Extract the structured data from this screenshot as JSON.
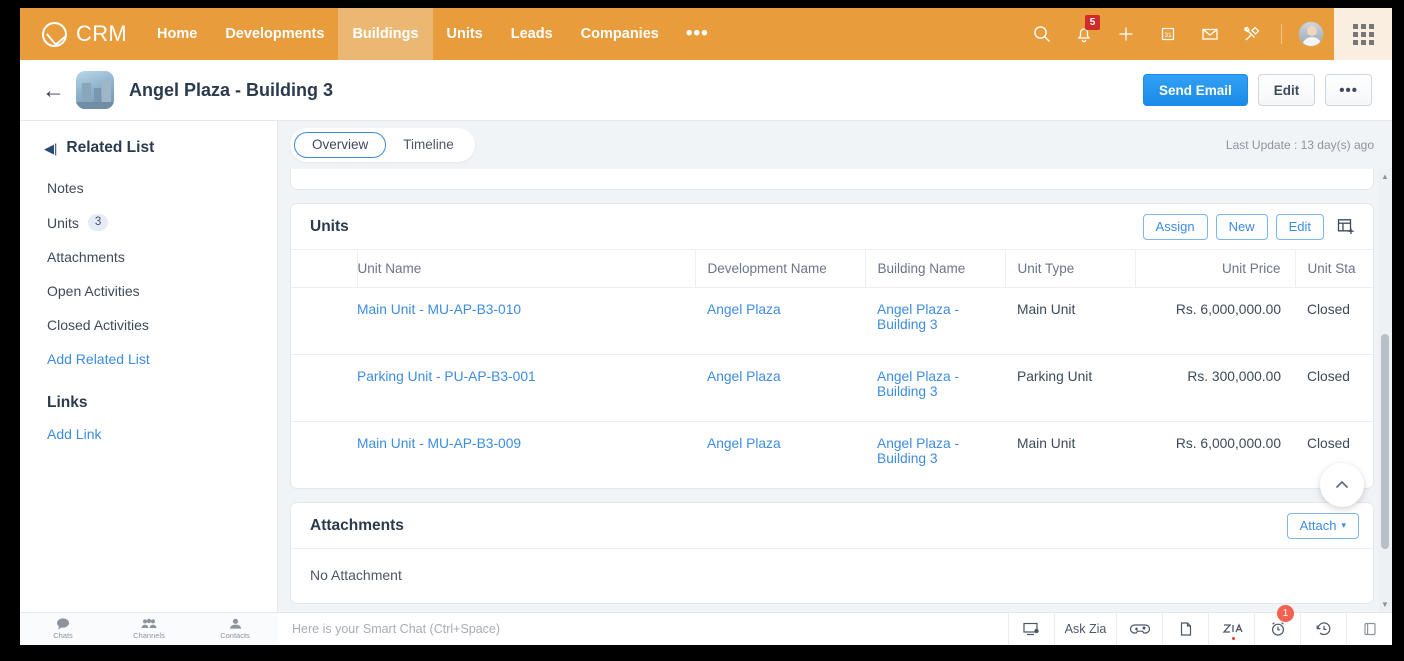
{
  "topnav": {
    "brand": "CRM",
    "items": [
      {
        "label": "Home",
        "active": false
      },
      {
        "label": "Developments",
        "active": false
      },
      {
        "label": "Buildings",
        "active": true
      },
      {
        "label": "Units",
        "active": false
      },
      {
        "label": "Leads",
        "active": false
      },
      {
        "label": "Companies",
        "active": false
      }
    ],
    "more": "•••",
    "icons": [
      "search-icon",
      "notification-bell-icon",
      "plus-icon",
      "calendar-icon",
      "mail-icon",
      "tools-icon"
    ],
    "notification_count": "5",
    "apps_icon": "apps-grid-icon"
  },
  "titlebar": {
    "back_icon": "back-arrow-icon",
    "thumbnail": "building-photo",
    "title": "Angel Plaza - Building 3",
    "send_email_label": "Send Email",
    "edit_label": "Edit",
    "more_label": "•••"
  },
  "sidebar": {
    "collapse_icon": "collapse-panel-icon",
    "title": "Related List",
    "items": [
      {
        "label": "Notes",
        "count": "",
        "link": false
      },
      {
        "label": "Units",
        "count": "3",
        "link": false
      },
      {
        "label": "Attachments",
        "count": "",
        "link": false
      },
      {
        "label": "Open Activities",
        "count": "",
        "link": false
      },
      {
        "label": "Closed Activities",
        "count": "",
        "link": false
      },
      {
        "label": "Add Related List",
        "count": "",
        "link": true
      }
    ],
    "links_title": "Links",
    "add_link_label": "Add Link",
    "footer": [
      {
        "label": "Chats",
        "icon": "chat-bubble-icon"
      },
      {
        "label": "Channels",
        "icon": "channels-group-icon"
      },
      {
        "label": "Contacts",
        "icon": "contacts-person-icon"
      }
    ]
  },
  "main": {
    "tabs": [
      {
        "label": "Overview",
        "active": true
      },
      {
        "label": "Timeline",
        "active": false
      }
    ],
    "last_update": "Last Update : 13 day(s) ago",
    "units_card": {
      "title": "Units",
      "assign_label": "Assign",
      "new_label": "New",
      "edit_label": "Edit",
      "columns_icon": "add-column-icon",
      "columns": [
        "Unit Name",
        "Development Name",
        "Building Name",
        "Unit Type",
        "Unit Price",
        "Unit Sta"
      ],
      "rows": [
        {
          "unit_name": "Main Unit - MU-AP-B3-010",
          "development_name": "Angel Plaza",
          "building_name": "Angel Plaza - Building 3",
          "unit_type": "Main Unit",
          "unit_price": "Rs. 6,000,000.00",
          "unit_status": "Closed"
        },
        {
          "unit_name": "Parking Unit - PU-AP-B3-001",
          "development_name": "Angel Plaza",
          "building_name": "Angel Plaza - Building 3",
          "unit_type": "Parking Unit",
          "unit_price": "Rs. 300,000.00",
          "unit_status": "Closed"
        },
        {
          "unit_name": "Main Unit - MU-AP-B3-009",
          "development_name": "Angel Plaza",
          "building_name": "Angel Plaza - Building 3",
          "unit_type": "Main Unit",
          "unit_price": "Rs. 6,000,000.00",
          "unit_status": "Closed"
        }
      ]
    },
    "attachments_card": {
      "title": "Attachments",
      "attach_label": "Attach",
      "attach_caret": "▾",
      "empty_text": "No Attachment"
    },
    "scroll_top_icon": "chevron-up-icon"
  },
  "bottombar": {
    "smart_chat_placeholder": "Here is your Smart Chat (Ctrl+Space)",
    "items": [
      {
        "label": "",
        "icon": "screen-share-icon",
        "badge": ""
      },
      {
        "label": "Ask Zia",
        "icon": "",
        "badge": ""
      },
      {
        "label": "",
        "icon": "gamepad-icon",
        "badge": ""
      },
      {
        "label": "",
        "icon": "notes-icon",
        "badge": ""
      },
      {
        "label": "",
        "icon": "zia-icon",
        "badge": ""
      },
      {
        "label": "",
        "icon": "alarm-clock-icon",
        "badge": "1"
      },
      {
        "label": "",
        "icon": "history-clock-icon",
        "badge": ""
      },
      {
        "label": "",
        "icon": "archive-icon",
        "badge": ""
      }
    ]
  },
  "colors": {
    "nav_orange": "#e89c3c",
    "nav_active": "#eab873",
    "primary_blue": "#1b8ae8",
    "link_blue": "#3d8ce0",
    "badge_red": "#cf2b2b",
    "badge_orange": "#f2624e"
  }
}
